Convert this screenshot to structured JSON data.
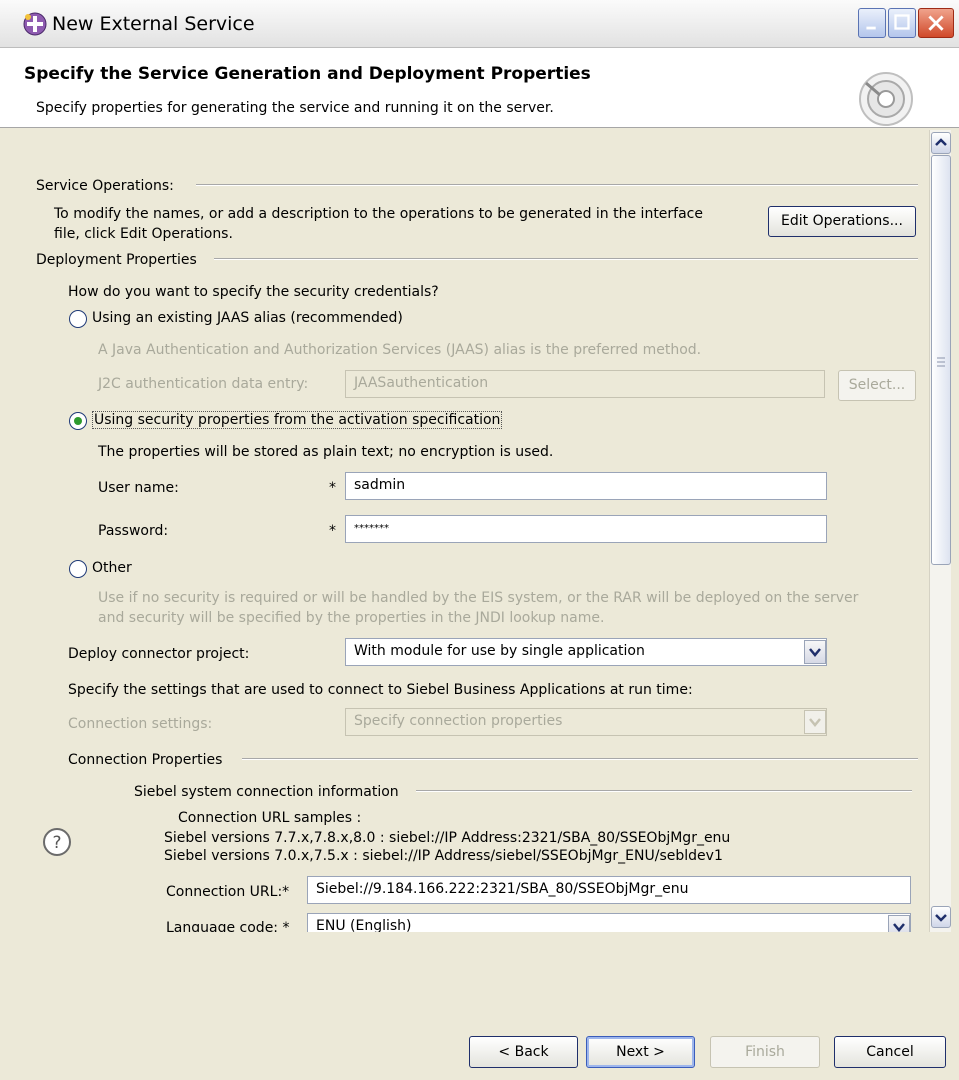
{
  "window": {
    "title": "New External Service"
  },
  "banner": {
    "heading": "Specify the Service Generation and Deployment Properties",
    "description": "Specify properties for generating the service and running it on the server."
  },
  "service_operations": {
    "group_title": "Service Operations:",
    "text_line1": "To modify the names, or add a description to the operations to be generated in the interface",
    "text_line2": "file, click Edit Operations.",
    "edit_button": "Edit Operations..."
  },
  "deployment": {
    "group_title": "Deployment Properties",
    "question": "How do you want to specify the security credentials?",
    "option_jaas": {
      "label": "Using an existing JAAS alias (recommended)",
      "selected": false,
      "description": "A Java Authentication and Authorization Services (JAAS) alias is the preferred method.",
      "field_label": "J2C authentication data entry:",
      "field_value": "JAASauthentication",
      "select_button": "Select..."
    },
    "option_activation": {
      "label": "Using security properties from the activation specification",
      "selected": true,
      "note": "The properties will be stored as plain text; no encryption is used.",
      "user_label": "User name:",
      "user_required": "*",
      "user_value": "sadmin",
      "password_label": "Password:",
      "password_required": "*",
      "password_value": "*******"
    },
    "option_other": {
      "label": "Other",
      "selected": false,
      "description_line1": "Use if no security is required or will be handled by the EIS system, or the RAR will be deployed on the server",
      "description_line2": "and security will be specified by the properties in the JNDI lookup name."
    },
    "deploy_label": "Deploy connector project:",
    "deploy_value": "With module for use by single application",
    "settings_intro": "Specify the settings that are used to connect to Siebel Business Applications at run time:",
    "connection_settings_label": "Connection settings:",
    "connection_settings_value": "Specify connection properties"
  },
  "connection_properties": {
    "group_title": "Connection Properties",
    "siebel_group_title": "Siebel system connection information",
    "samples_heading": "Connection URL samples :",
    "sample1": "Siebel versions 7.7.x,7.8.x,8.0 :   siebel://IP Address:2321/SBA_80/SSEObjMgr_enu",
    "sample2": "Siebel versions 7.0.x,7.5.x :   siebel://IP Address/siebel/SSEObjMgr_ENU/sebldev1",
    "url_label": "Connection URL:*",
    "url_value": "Siebel://9.184.166.222:2321/SBA_80/SSEObjMgr_enu",
    "language_label": "Language code: *",
    "language_value": "ENU (English)"
  },
  "footer": {
    "back": "< Back",
    "next": "Next >",
    "finish": "Finish",
    "cancel": "Cancel"
  }
}
